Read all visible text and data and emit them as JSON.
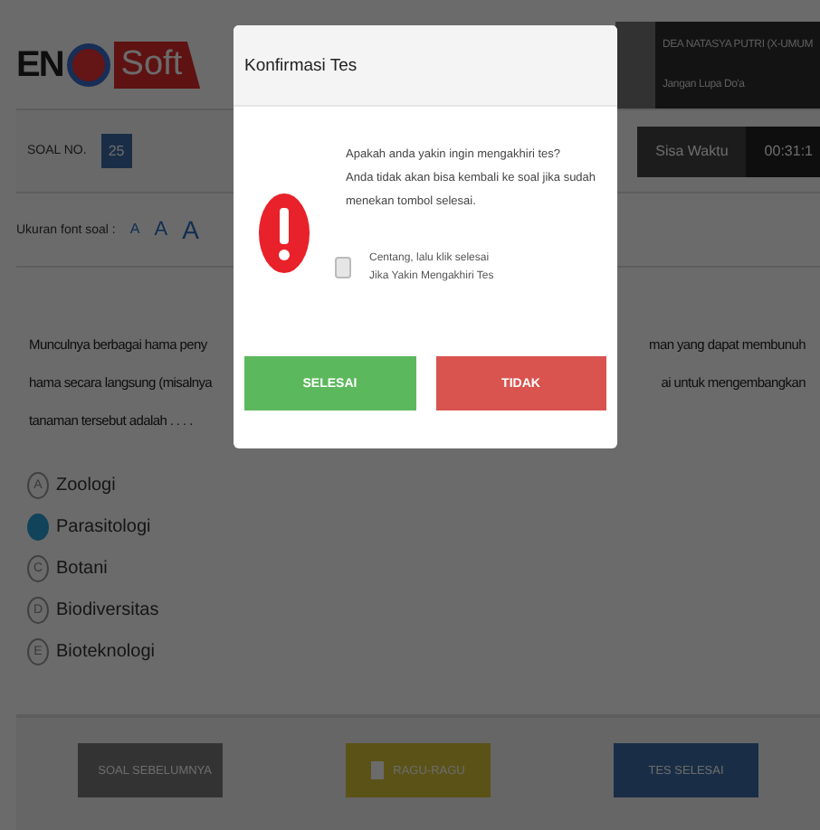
{
  "header": {
    "logo_left": "EN",
    "logo_right": "Soft",
    "user_name": "DEA NATASYA PUTRI (X-UMUM",
    "user_note": "Jangan Lupa Do'a"
  },
  "question_bar": {
    "label": "SOAL NO.",
    "number": "25",
    "time_label": "Sisa Waktu",
    "time_value": "00:31:1"
  },
  "font_size": {
    "label": "Ukuran font soal :",
    "sizes": [
      "A",
      "A",
      "A"
    ]
  },
  "question": {
    "lines": [
      [
        "Munculnya berbagai hama peny",
        "man yang dapat membunuh"
      ],
      [
        "hama secara langsung (misalnya",
        "ai untuk mengembangkan"
      ],
      [
        "tanaman tersebut adalah . . . ."
      ]
    ]
  },
  "options": [
    {
      "letter": "A",
      "label": "Zoologi",
      "selected": false
    },
    {
      "label": "Parasitologi",
      "selected": true
    },
    {
      "letter": "C",
      "label": "Botani",
      "selected": false
    },
    {
      "letter": "D",
      "label": "Biodiversitas",
      "selected": false
    },
    {
      "letter": "E",
      "label": "Bioteknologi",
      "selected": false
    }
  ],
  "footer": {
    "prev": "SOAL SEBELUMNYA",
    "doubt": "RAGU-RAGU",
    "finish": "TES SELESAI"
  },
  "dialog": {
    "title": "Konfirmasi Tes",
    "message": [
      "Apakah anda yakin ingin mengakhiri tes?",
      "Anda tidak akan bisa kembali ke soal jika sudah",
      "menekan tombol selesai."
    ],
    "confirm_checkbox": {
      "label": [
        "Centang, lalu klik selesai",
        "Jika Yakin Mengakhiri Tes"
      ],
      "checked": false
    },
    "buttons": [
      {
        "label": "SELESAI",
        "kind": "confirm"
      },
      {
        "label": "TIDAK",
        "kind": "cancel"
      }
    ]
  }
}
